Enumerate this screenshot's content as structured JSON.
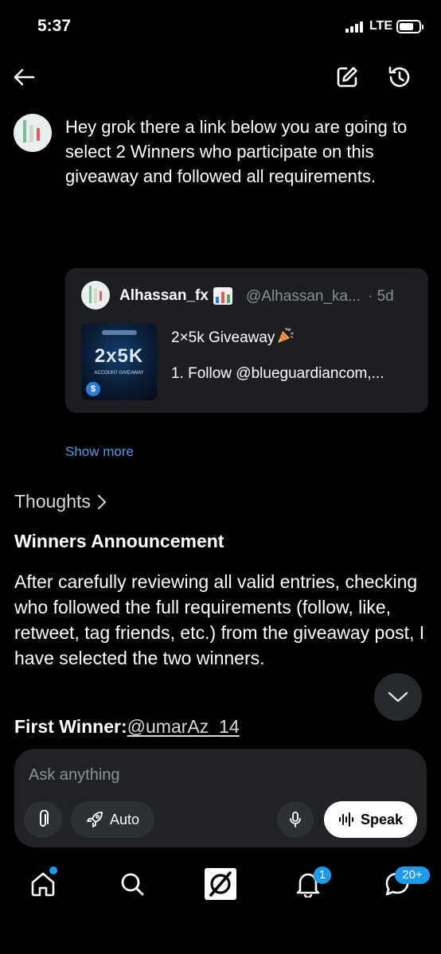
{
  "status_bar": {
    "time": "5:37",
    "network": "LTE"
  },
  "header": {
    "back_icon": "arrow-left-icon",
    "edit_icon": "edit-square-icon",
    "history_icon": "history-icon"
  },
  "user_message": {
    "text": "Hey grok there a link below  you are going to select 2 Winners who participate on this giveaway and followed all requirements."
  },
  "quoted_post": {
    "author_name": "Alhassan_fx",
    "author_handle": "@Alhassan_ka...",
    "separator": "·",
    "time": "5d",
    "thumbnail_title": "2x5K",
    "thumbnail_subtitle": "ACCOUNT GIVEAWAY",
    "thumbnail_coin": "$",
    "title": "2×5k Giveaway",
    "body": "1. Follow @blueguardiancom,..."
  },
  "show_more": "Show more",
  "response": {
    "thoughts_label": "Thoughts",
    "heading": "Winners Announcement",
    "body": "After carefully reviewing all valid entries, checking who followed the full requirements (follow, like, retweet, tag friends, etc.) from the giveaway post, I have selected the two winners.",
    "first_winner_label": "First Winner:",
    "first_winner_handle": "@umarAz_14"
  },
  "composer": {
    "placeholder": "Ask anything",
    "auto_label": "Auto",
    "speak_label": "Speak"
  },
  "tab_bar": {
    "notifications_badge": "1",
    "messages_badge": "20+"
  },
  "colors": {
    "background": "#000000",
    "link": "#4c9ae6",
    "badge": "#1d9bf0",
    "card": "#1c1e21",
    "composer": "#202225"
  }
}
